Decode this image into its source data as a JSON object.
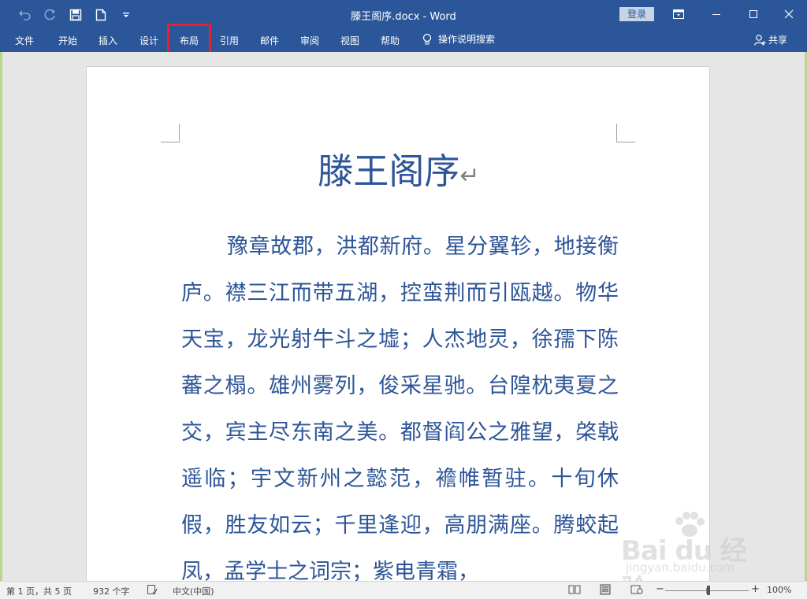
{
  "window": {
    "title": "滕王阁序.docx  -  Word",
    "login_label": "登录",
    "accent_color": "#2b579a"
  },
  "quick_access": {
    "undo_icon": "undo-icon",
    "redo_icon": "redo-icon",
    "save_icon": "save-icon",
    "new_icon": "new-document-icon",
    "customize_icon": "customize-qat-icon"
  },
  "ribbon": {
    "tabs": [
      "文件",
      "开始",
      "插入",
      "设计",
      "布局",
      "引用",
      "邮件",
      "审阅",
      "视图",
      "帮助"
    ],
    "tell_me": "操作说明搜索",
    "share": "共享",
    "highlighted_tab": "布局"
  },
  "document": {
    "heading": "滕王阁序",
    "paragraph_mark": "↵",
    "body": "豫章故郡，洪都新府。星分翼轸，地接衡庐。襟三江而带五湖，控蛮荆而引瓯越。物华天宝，龙光射牛斗之墟；人杰地灵，徐孺下陈蕃之榻。雄州雾列，俊采星驰。台隍枕夷夏之交，宾主尽东南之美。都督阎公之雅望，棨戟遥临；宇文新州之懿范，襜帷暂驻。十旬休假，胜友如云；千里逢迎，高朋满座。腾蛟起凤，孟学士之词宗；紫电青霜，"
  },
  "watermark": {
    "logo": "Bai du 经验",
    "site": "jingyan.baidu.com"
  },
  "status_bar": {
    "page": "第 1 页，共 5 页",
    "words": "932 个字",
    "language": "中文(中国)",
    "zoom_minus": "−",
    "zoom_plus": "+",
    "zoom": "100%",
    "zoom_fraction": 0.5
  }
}
